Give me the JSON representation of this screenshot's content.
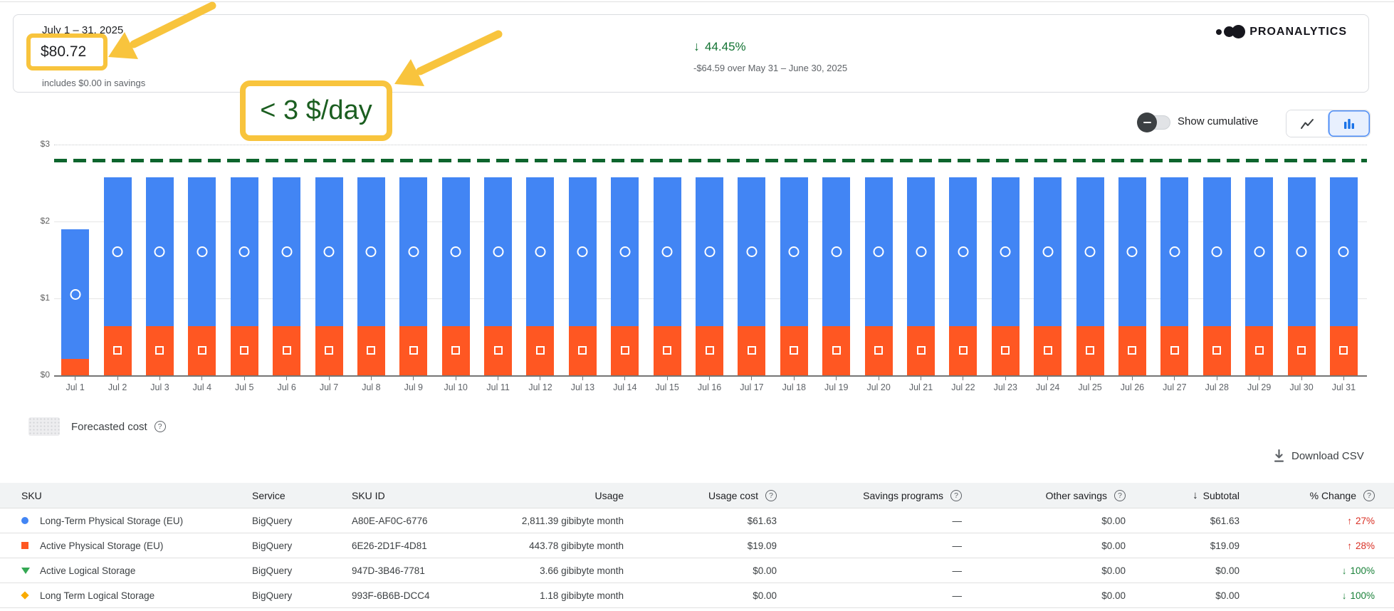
{
  "colors": {
    "yellow": "#f8c43d",
    "blue": "#4285f4",
    "orange": "#ff5722",
    "green": "#137333",
    "green2": "#188038",
    "refgreen": "#0d652d",
    "red": "#d93025"
  },
  "header_card": {
    "period": "July 1 – 31, 2025",
    "total_cost": "$80.72",
    "savings_note": "includes $0.00 in savings",
    "delta_arrow": "↓",
    "delta_pct": "44.45%",
    "delta_compare": "-$64.59 over May 31 – June 30, 2025",
    "brand": "PROANALYTICS"
  },
  "annotations": {
    "daily_note": "< 3 $/day"
  },
  "controls": {
    "toggle_label": "Show cumulative",
    "buttons": [
      {
        "icon": "line-chart-icon",
        "selected": false
      },
      {
        "icon": "bar-chart-icon",
        "selected": true
      }
    ]
  },
  "chart_data": {
    "type": "bar",
    "stacked": true,
    "x": [
      "Jul 1",
      "Jul 2",
      "Jul 3",
      "Jul 4",
      "Jul 5",
      "Jul 6",
      "Jul 7",
      "Jul 8",
      "Jul 9",
      "Jul 10",
      "Jul 11",
      "Jul 12",
      "Jul 13",
      "Jul 14",
      "Jul 15",
      "Jul 16",
      "Jul 17",
      "Jul 18",
      "Jul 19",
      "Jul 20",
      "Jul 21",
      "Jul 22",
      "Jul 23",
      "Jul 24",
      "Jul 25",
      "Jul 26",
      "Jul 27",
      "Jul 28",
      "Jul 29",
      "Jul 30",
      "Jul 31"
    ],
    "series": [
      {
        "name": "Active Physical Storage (EU)",
        "color": "#ff5722",
        "marker": "square",
        "values": [
          0.21,
          0.64,
          0.64,
          0.64,
          0.64,
          0.64,
          0.64,
          0.64,
          0.64,
          0.64,
          0.64,
          0.64,
          0.64,
          0.64,
          0.64,
          0.64,
          0.64,
          0.64,
          0.64,
          0.64,
          0.64,
          0.64,
          0.64,
          0.64,
          0.64,
          0.64,
          0.64,
          0.64,
          0.64,
          0.64,
          0.64
        ]
      },
      {
        "name": "Long-Term Physical Storage (EU)",
        "color": "#4285f4",
        "marker": "circle",
        "values": [
          1.69,
          1.93,
          1.93,
          1.93,
          1.93,
          1.93,
          1.93,
          1.93,
          1.93,
          1.93,
          1.93,
          1.93,
          1.93,
          1.93,
          1.93,
          1.93,
          1.93,
          1.93,
          1.93,
          1.93,
          1.93,
          1.93,
          1.93,
          1.93,
          1.93,
          1.93,
          1.93,
          1.93,
          1.93,
          1.93,
          1.93
        ]
      }
    ],
    "ylim": [
      0,
      3
    ],
    "yticks": [
      {
        "label": "$0",
        "value": 0
      },
      {
        "label": "$1",
        "value": 1
      },
      {
        "label": "$2",
        "value": 2
      },
      {
        "label": "$3",
        "value": 3
      }
    ],
    "reference_line": {
      "value": 2.8,
      "style": "dashed",
      "color": "#0d652d"
    },
    "grid": true,
    "legend_position": "bottom-left"
  },
  "legend": {
    "forecast_label": "Forecasted cost"
  },
  "download": {
    "label": "Download CSV"
  },
  "table": {
    "columns": [
      {
        "label": "SKU",
        "align": "left"
      },
      {
        "label": "Service",
        "align": "left"
      },
      {
        "label": "SKU ID",
        "align": "left"
      },
      {
        "label": "Usage",
        "align": "right"
      },
      {
        "label": "Usage cost",
        "align": "right",
        "help": true
      },
      {
        "label": "Savings programs",
        "align": "right",
        "help": true
      },
      {
        "label": "Other savings",
        "align": "right",
        "help": true
      },
      {
        "label": "Subtotal",
        "align": "right",
        "sort": "desc"
      },
      {
        "label": "% Change",
        "align": "right",
        "help": true
      }
    ],
    "rows": [
      {
        "marker": "circle",
        "marker_color": "#4285f4",
        "sku": "Long-Term Physical Storage (EU)",
        "service": "BigQuery",
        "sku_id": "A80E-AF0C-6776",
        "usage": "2,811.39 gibibyte month",
        "usage_cost": "$61.63",
        "savings_programs": "—",
        "other_savings": "$0.00",
        "subtotal": "$61.63",
        "change": "27%",
        "change_dir": "up"
      },
      {
        "marker": "square",
        "marker_color": "#ff5722",
        "sku": "Active Physical Storage (EU)",
        "service": "BigQuery",
        "sku_id": "6E26-2D1F-4D81",
        "usage": "443.78 gibibyte month",
        "usage_cost": "$19.09",
        "savings_programs": "—",
        "other_savings": "$0.00",
        "subtotal": "$19.09",
        "change": "28%",
        "change_dir": "up"
      },
      {
        "marker": "triangle-down",
        "marker_color": "#34a853",
        "sku": "Active Logical Storage",
        "service": "BigQuery",
        "sku_id": "947D-3B46-7781",
        "usage": "3.66 gibibyte month",
        "usage_cost": "$0.00",
        "savings_programs": "—",
        "other_savings": "$0.00",
        "subtotal": "$0.00",
        "change": "100%",
        "change_dir": "down"
      },
      {
        "marker": "diamond",
        "marker_color": "#f9ab00",
        "sku": "Long Term Logical Storage",
        "service": "BigQuery",
        "sku_id": "993F-6B6B-DCC4",
        "usage": "1.18 gibibyte month",
        "usage_cost": "$0.00",
        "savings_programs": "—",
        "other_savings": "$0.00",
        "subtotal": "$0.00",
        "change": "100%",
        "change_dir": "down"
      }
    ]
  }
}
